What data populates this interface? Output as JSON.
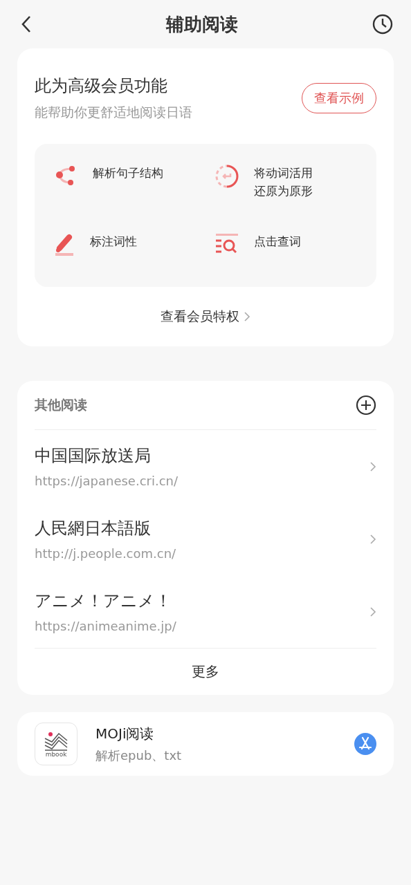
{
  "header": {
    "title": "辅助阅读"
  },
  "premium": {
    "title": "此为高级会员功能",
    "subtitle": "能帮助你更舒适地阅读日语",
    "example_button": "查看示例",
    "features": [
      {
        "kind": "structure",
        "label": "解析句子结构"
      },
      {
        "kind": "restore",
        "lines": [
          "将动词活用",
          "还原为原形"
        ]
      },
      {
        "kind": "pen",
        "label": "标注词性"
      },
      {
        "kind": "lookup",
        "label": "点击查词"
      }
    ],
    "link": "查看会员特权"
  },
  "other": {
    "title": "其他阅读",
    "sites": [
      {
        "name": "中国国际放送局",
        "url": "https://japanese.cri.cn/"
      },
      {
        "name": "人民網日本語版",
        "url": "http://j.people.com.cn/"
      },
      {
        "name": "アニメ！アニメ！",
        "url": "https://animeanime.jp/"
      }
    ],
    "more": "更多"
  },
  "app": {
    "logo_text": "mbook",
    "name": "MOJi阅读",
    "description": "解析epub、txt"
  }
}
